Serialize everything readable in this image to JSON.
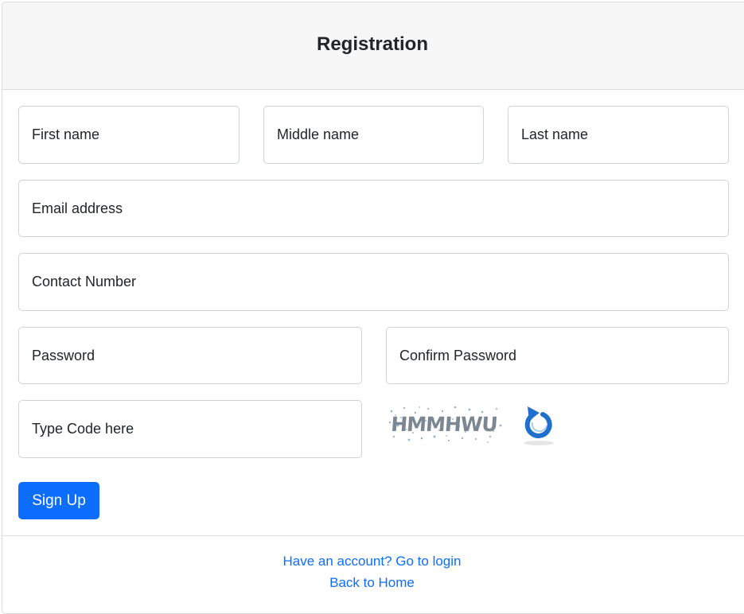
{
  "header": {
    "title": "Registration"
  },
  "form": {
    "first_name": {
      "placeholder": "First name"
    },
    "middle_name": {
      "placeholder": "Middle name"
    },
    "last_name": {
      "placeholder": "Last name"
    },
    "email": {
      "placeholder": "Email address"
    },
    "contact": {
      "placeholder": "Contact Number"
    },
    "password": {
      "placeholder": "Password"
    },
    "confirm_password": {
      "placeholder": "Confirm Password"
    },
    "captcha_input": {
      "placeholder": "Type Code here"
    },
    "captcha_code": "HMMHWU",
    "refresh_icon": "refresh-icon",
    "signup_label": "Sign Up"
  },
  "footer": {
    "login_link": "Have an account? Go to login",
    "home_link": "Back to Home"
  },
  "colors": {
    "primary": "#0d6efd",
    "refresh_icon": "#1f6fcf",
    "header_bg": "#f7f7f7"
  }
}
